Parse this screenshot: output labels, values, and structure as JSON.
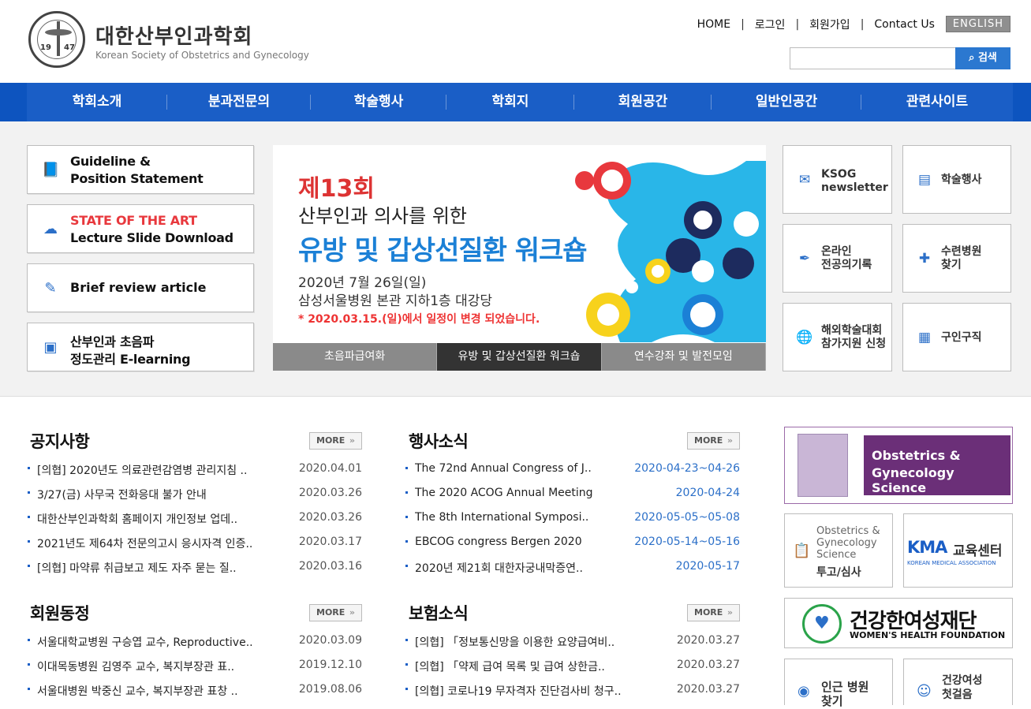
{
  "header": {
    "org_name_ko": "대한산부인과학회",
    "org_name_en": "Korean Society of Obstetrics and Gynecology",
    "emblem_year_left": "19",
    "emblem_year_right": "47",
    "util_links": [
      "HOME",
      "로그인",
      "회원가입",
      "Contact Us"
    ],
    "english_label": "ENGLISH",
    "search_placeholder": "",
    "search_label": "검색"
  },
  "gnb": {
    "items": [
      "학회소개",
      "분과전문의",
      "학술행사",
      "학회지",
      "회원공간",
      "일반인공간",
      "관련사이트"
    ]
  },
  "quick_left": [
    {
      "line1": "Guideline &",
      "line2": "Position Statement",
      "icon": "book-icon"
    },
    {
      "line1": "STATE OF THE ART",
      "line2": "Lecture Slide Download",
      "icon": "upload-cloud-icon"
    },
    {
      "line1": "Brief review article",
      "icon": "pencil-icon"
    },
    {
      "line1": "산부인과 초음파",
      "line2": "정도관리 E-learning",
      "icon": "monitor-icon"
    }
  ],
  "banner": {
    "title_prefix": "제13회",
    "subtitle": "산부인과 의사를 위한",
    "headline": "유방 및 갑상선질환 워크숍",
    "date": "2020년 7월 26일(일)",
    "venue": "삼성서울병원 본관 지하1층 대강당",
    "notice": "* 2020.03.15.(일)에서 일정이 변경 되었습니다.",
    "tabs": [
      "초음파급여화",
      "유방 및 갑상선질환 워크숍",
      "연수강좌 및 발전모임"
    ],
    "active_tab": 1,
    "colors": {
      "red": "#e8383d",
      "blue": "#1b80d6",
      "cyan": "#29b6e8",
      "navy": "#1d2b5e",
      "yellow": "#f7d21c"
    }
  },
  "quick_right": [
    {
      "line1": "KSOG",
      "line2": "newsletter",
      "icon": "mail-icon"
    },
    {
      "line1": "학술행사",
      "icon": "briefcase-icon"
    },
    {
      "line1": "온라인",
      "line2": "전공의기록",
      "icon": "pen-icon"
    },
    {
      "line1": "수련병원",
      "line2": "찾기",
      "icon": "hospital-icon"
    },
    {
      "line1": "해외학술대회",
      "line2": "참가지원 신청",
      "icon": "globe-icon"
    },
    {
      "line1": "구인구직",
      "icon": "bag-icon"
    }
  ],
  "notices": {
    "title": "공지사항",
    "more": "MORE",
    "items": [
      {
        "title": "[의협] 2020년도 의료관련감염병 관리지침 ..",
        "date": "2020.04.01"
      },
      {
        "title": "3/27(금) 사무국 전화응대 불가 안내",
        "date": "2020.03.26"
      },
      {
        "title": "대한산부인과학회 홈페이지 개인정보 업데..",
        "date": "2020.03.26"
      },
      {
        "title": "2021년도 제64차 전문의고시 응시자격 인증..",
        "date": "2020.03.17"
      },
      {
        "title": "[의협] 마약류 취급보고 제도 자주 묻는 질..",
        "date": "2020.03.16"
      }
    ]
  },
  "events": {
    "title": "행사소식",
    "more": "MORE",
    "items": [
      {
        "title": "The 72nd Annual Congress of J..",
        "date": "2020-04-23~04-26"
      },
      {
        "title": "The 2020 ACOG Annual Meeting",
        "date": "2020-04-24"
      },
      {
        "title": "The 8th International Symposi..",
        "date": "2020-05-05~05-08"
      },
      {
        "title": "EBCOG congress Bergen 2020",
        "date": "2020-05-14~05-16"
      },
      {
        "title": "2020년 제21회 대한자궁내막증연..",
        "date": "2020-05-17"
      }
    ]
  },
  "members": {
    "title": "회원동정",
    "more": "MORE",
    "items": [
      {
        "title": "서울대학교병원 구승엽 교수, Reproductive..",
        "date": "2020.03.09"
      },
      {
        "title": "이대목동병원 김영주 교수, 복지부장관 표..",
        "date": "2019.12.10"
      },
      {
        "title": "서울대병원 박중신 교수, 복지부장관 표창 ..",
        "date": "2019.08.06"
      }
    ]
  },
  "insurance": {
    "title": "보험소식",
    "more": "MORE",
    "items": [
      {
        "title": "[의협] 「정보통신망을 이용한 요양급여비..",
        "date": "2020.03.27"
      },
      {
        "title": "[의협] 「약제 급여 목록 및 급여 상한금..",
        "date": "2020.03.27"
      },
      {
        "title": "[의협] 코로나19 무자격자 진단검사비 청구..",
        "date": "2020.03.27"
      }
    ]
  },
  "right_banners": {
    "ogs_title1": "Obstetrics &",
    "ogs_title2": "Gynecology Science",
    "ogs_submit_l1": "Obstetrics &",
    "ogs_submit_l2": "Gynecology",
    "ogs_submit_l3": "Science",
    "ogs_submit_l4": "투고/심사",
    "kma_logo": "KMA",
    "kma_label": "교육센터",
    "kma_sub": "KOREAN MEDICAL ASSOCIATION",
    "whf_ko": "건강한여성재단",
    "whf_en": "WOMEN'S HEALTH FOUNDATION",
    "hospital_l1": "인근 병원",
    "hospital_l2": "찾기",
    "walk_l1": "건강여성",
    "walk_l2": "첫걸음"
  }
}
